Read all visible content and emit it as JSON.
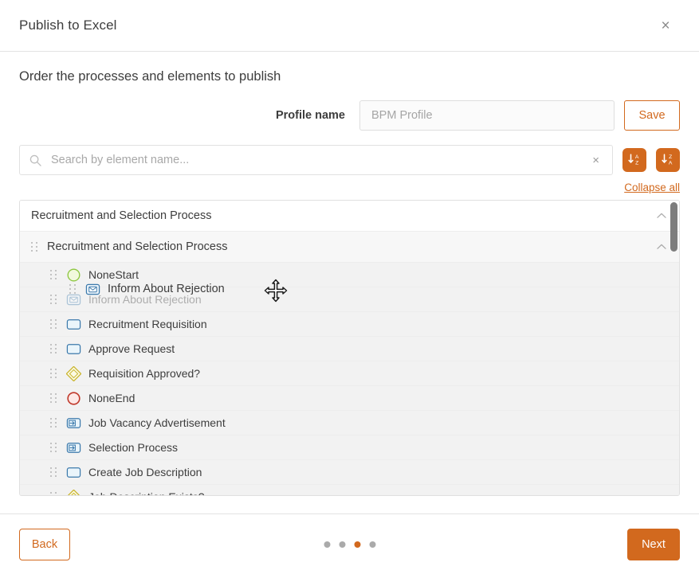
{
  "dialog": {
    "title": "Publish to Excel",
    "close_label": "×",
    "section_title": "Order the processes and elements to publish"
  },
  "profile": {
    "label": "Profile name",
    "value": "",
    "placeholder": "BPM Profile",
    "save_label": "Save"
  },
  "search": {
    "value": "",
    "placeholder": "Search by element name...",
    "clear_label": "×",
    "icon": "search-icon",
    "sort_asc_icon": "sort-ascending-az-icon",
    "sort_desc_icon": "sort-descending-za-icon"
  },
  "tree_toolbar": {
    "collapse_all_label": "Collapse all"
  },
  "tree": {
    "root": {
      "label": "Recruitment and Selection Process",
      "expanded": true,
      "chevron": "chevron-up-icon"
    },
    "group": {
      "label": "Recruitment and Selection Process",
      "expanded": true,
      "chevron": "chevron-up-icon"
    },
    "items": [
      {
        "label": "NoneStart",
        "icon": "bpmn-start-event-icon",
        "dragging": false
      },
      {
        "label": "Inform About Rejection",
        "icon": "bpmn-send-task-icon",
        "dragging": true
      },
      {
        "label": "Recruitment Requisition",
        "icon": "bpmn-task-icon",
        "dragging": false
      },
      {
        "label": "Approve Request",
        "icon": "bpmn-task-icon",
        "dragging": false
      },
      {
        "label": "Requisition Approved?",
        "icon": "bpmn-gateway-icon",
        "dragging": false
      },
      {
        "label": "NoneEnd",
        "icon": "bpmn-end-event-icon",
        "dragging": false
      },
      {
        "label": "Job Vacancy Advertisement",
        "icon": "bpmn-subprocess-icon",
        "dragging": false
      },
      {
        "label": "Selection Process",
        "icon": "bpmn-subprocess-icon",
        "dragging": false
      },
      {
        "label": "Create Job Description",
        "icon": "bpmn-task-icon",
        "dragging": false
      },
      {
        "label": "Job Description Exists?",
        "icon": "bpmn-gateway-icon",
        "dragging": false
      }
    ],
    "drag_ghost_label": "Inform About Rejection",
    "cursor": "move-cursor"
  },
  "footer": {
    "back_label": "Back",
    "next_label": "Next",
    "step_count": 4,
    "active_step": 3
  },
  "colors": {
    "accent": "#d2691e",
    "text": "#3d3d3d",
    "muted": "#a5a5a5",
    "border": "#e0e0e0",
    "row_alt": "#f2f2f2",
    "bpmn_start": "#8cc63f",
    "bpmn_end": "#c0392b",
    "bpmn_task": "#4a86b8",
    "bpmn_gateway": "#c8b32a"
  }
}
